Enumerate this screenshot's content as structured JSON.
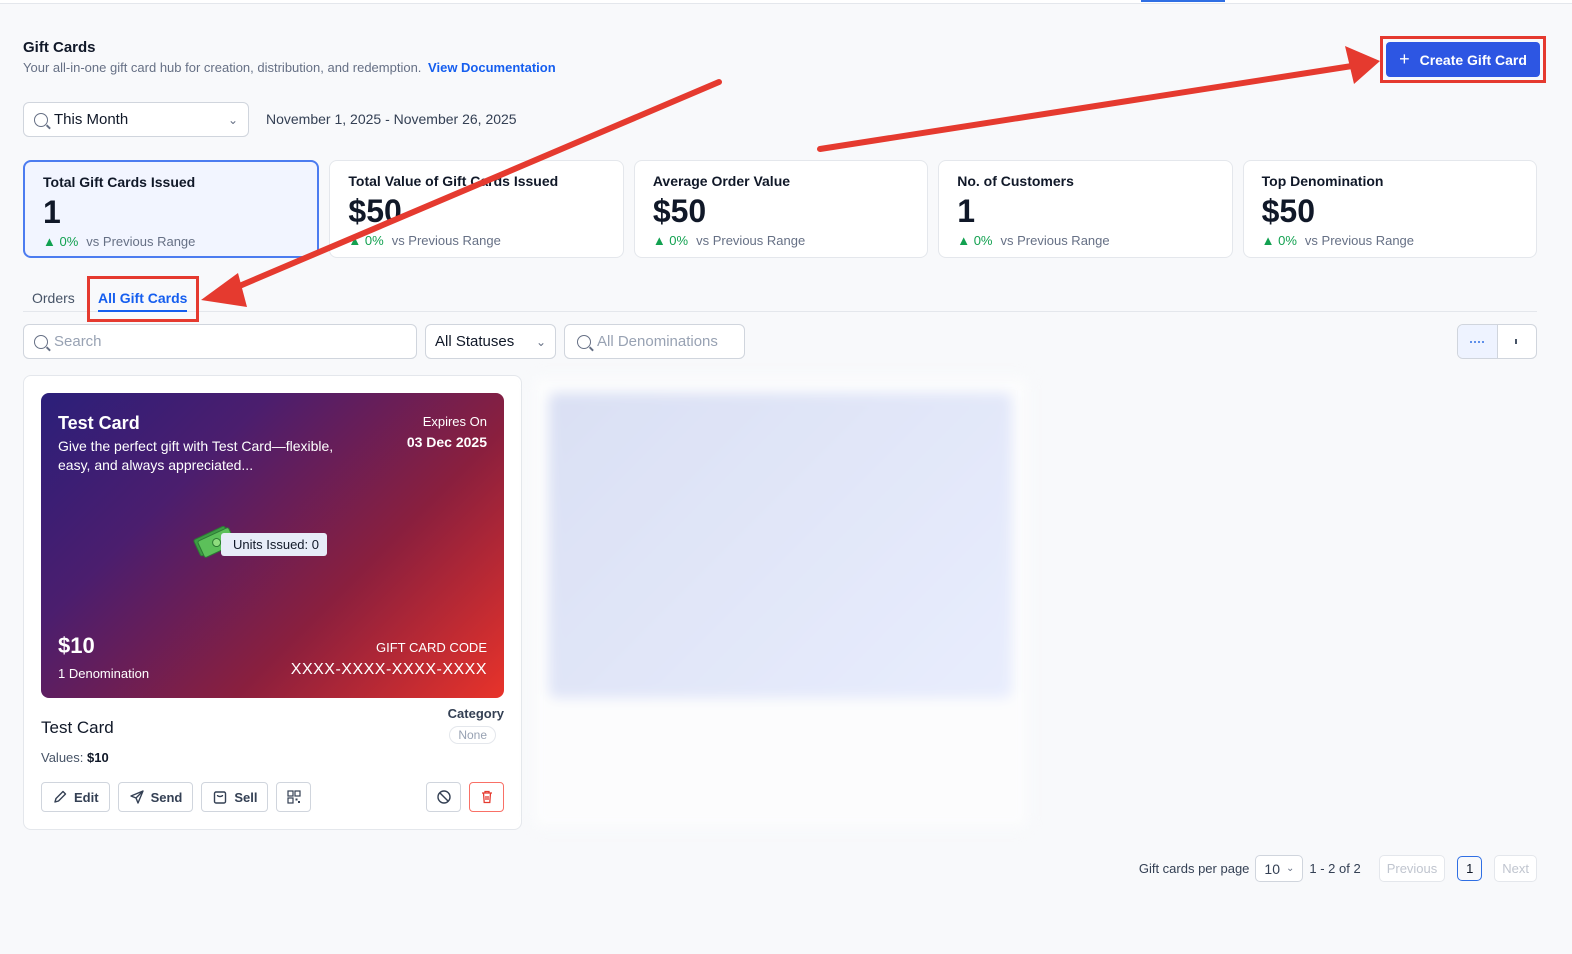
{
  "header": {
    "title": "Gift Cards",
    "subtitle": "Your all-in-one gift card hub for creation, distribution, and redemption.",
    "doc_link": "View Documentation",
    "create_button": "Create Gift Card"
  },
  "filter": {
    "range": "This Month",
    "date_range": "November 1, 2025 - November 26, 2025"
  },
  "stats": [
    {
      "label": "Total Gift Cards Issued",
      "value": "1",
      "change": "0%",
      "compare": "vs Previous Range"
    },
    {
      "label": "Total Value of Gift Cards Issued",
      "value": "$50",
      "change": "0%",
      "compare": "vs Previous Range"
    },
    {
      "label": "Average Order Value",
      "value": "$50",
      "change": "0%",
      "compare": "vs Previous Range"
    },
    {
      "label": "No. of Customers",
      "value": "1",
      "change": "0%",
      "compare": "vs Previous Range"
    },
    {
      "label": "Top Denomination",
      "value": "$50",
      "change": "0%",
      "compare": "vs Previous Range"
    }
  ],
  "tabs": {
    "orders": "Orders",
    "all": "All Gift Cards"
  },
  "toolbar": {
    "search_placeholder": "Search",
    "status": "All Statuses",
    "denominations_placeholder": "All Denominations"
  },
  "card": {
    "title": "Test Card",
    "description": "Give the perfect gift with Test Card—flexible, easy, and always appreciated...",
    "expires_label": "Expires On",
    "expires_value": "03 Dec 2025",
    "units": "Units Issued: 0",
    "price": "$10",
    "denominations": "1 Denomination",
    "code_label": "GIFT CARD CODE",
    "code_value": "XXXX-XXXX-XXXX-XXXX",
    "name": "Test Card",
    "values_label": "Values:",
    "values_value": "$10",
    "category_label": "Category",
    "category_value": "None",
    "edit": "Edit",
    "send": "Send",
    "sell": "Sell"
  },
  "pagination": {
    "per_page_label": "Gift cards per page",
    "per_page": "10",
    "range": "1 - 2 of 2",
    "previous": "Previous",
    "page": "1",
    "next": "Next"
  },
  "colors": {
    "accent": "#2d56e3",
    "highlight": "#e53a2f",
    "positive": "#12a150"
  },
  "icons": [
    "search-icon",
    "chevron-down-icon",
    "plus-icon",
    "grid-view-icon",
    "list-view-icon",
    "edit-icon",
    "send-icon",
    "shopping-bag-icon",
    "qr-code-icon",
    "ban-icon",
    "trash-icon",
    "money-icon",
    "arrow-up-icon"
  ]
}
